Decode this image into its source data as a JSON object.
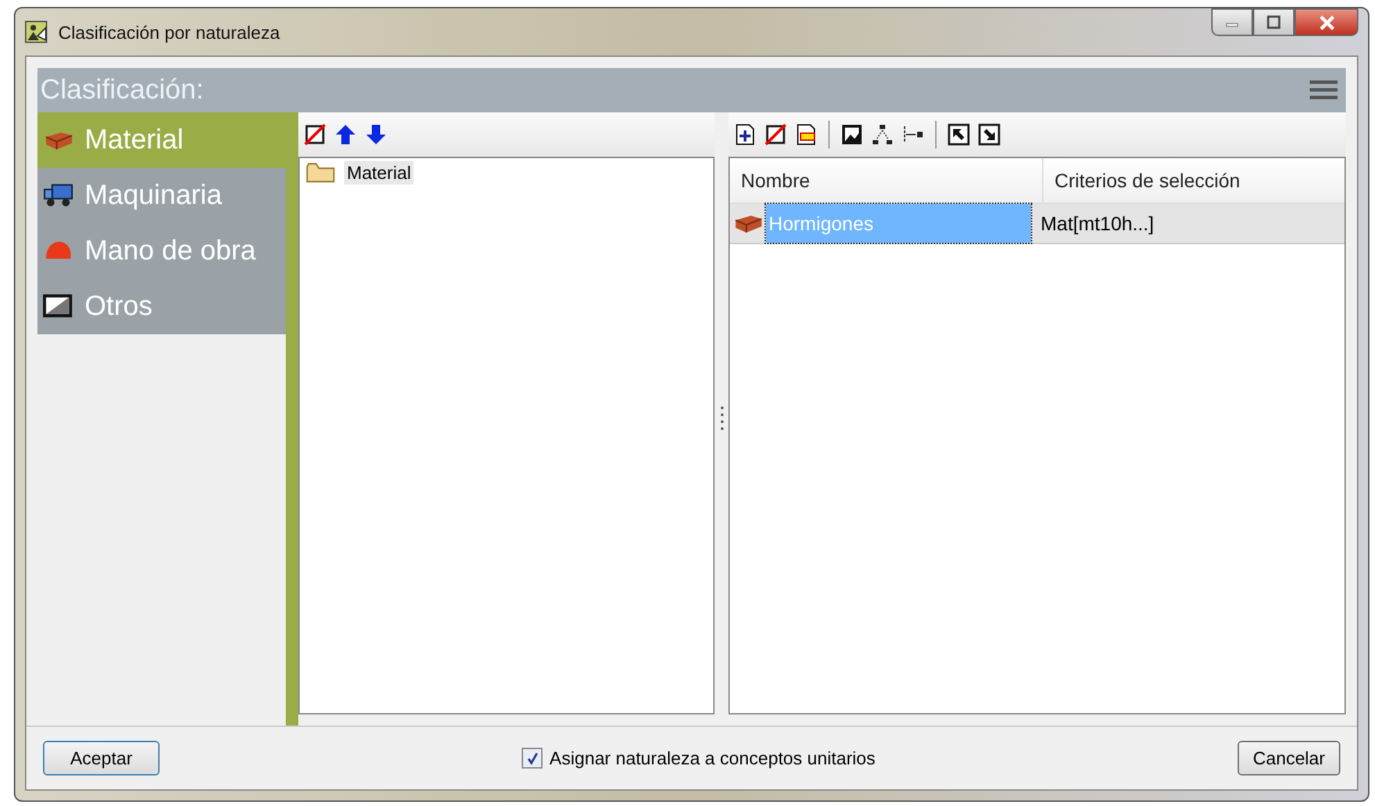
{
  "window": {
    "title": "Clasificación por naturaleza"
  },
  "header": {
    "title": "Clasificación:"
  },
  "sidebar": {
    "items": [
      {
        "label": "Material",
        "selected": true
      },
      {
        "label": "Maquinaria",
        "selected": false
      },
      {
        "label": "Mano de obra",
        "selected": false
      },
      {
        "label": "Otros",
        "selected": false
      }
    ]
  },
  "tree": {
    "items": [
      {
        "label": "Material",
        "selected": true
      }
    ]
  },
  "table": {
    "columns": [
      "Nombre",
      "Criterios de selección"
    ],
    "rows": [
      {
        "cells": [
          "Hormigones",
          "Mat[mt10h...]"
        ],
        "selected": true
      }
    ]
  },
  "footer": {
    "ok": "Aceptar",
    "checkbox": {
      "label": "Asignar naturaleza a conceptos unitarios",
      "checked": true
    },
    "cancel": "Cancelar"
  }
}
